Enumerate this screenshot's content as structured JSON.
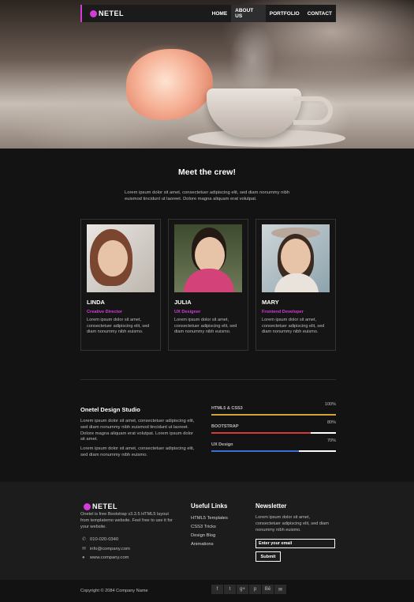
{
  "nav": {
    "logo": "NETEL",
    "items": [
      {
        "label": "HOME",
        "active": false
      },
      {
        "label": "ABOUT US",
        "active": true
      },
      {
        "label": "PORTFOLIO",
        "active": false
      },
      {
        "label": "CONTACT",
        "active": false
      }
    ]
  },
  "colors": {
    "accent": "#d43bd8",
    "bg": "#131313",
    "footer_bg": "#1c1c1c"
  },
  "crew": {
    "title": "Meet the crew!",
    "intro": "Lorem ipsum dolor sit amet, consectetuer adipiscing elit, sed diam nonummy nibh euismod tincidunt ut laoreet. Dolore magna aliquam erat volutpat.",
    "members": [
      {
        "name": "LINDA",
        "role": "Creative Director",
        "desc": "Lorem ipsum dolor sit amet, consectetuer adipiscing elit, sed diam nonummy nibh euismo."
      },
      {
        "name": "JULIA",
        "role": "UX Designer",
        "desc": "Lorem ipsum dolor sit amet, consectetuer adipiscing elit, sed diam nonummy nibh euismo."
      },
      {
        "name": "MARY",
        "role": "Frontend Developer",
        "desc": "Lorem ipsum dolor sit amet, consectetuer adipiscing elit, sed diam nonummy nibh euismo."
      }
    ]
  },
  "studio": {
    "title": "Onetel Design Studio",
    "p1": "Lorem ipsum dolor sit amet, consectetuer adipiscing elit, sed diam nonummy nibh euismod tincidunt ut laoreet. Dolore magna aliquam erat volutpat. Lorem ipsum dolor sit amet.",
    "p2": "Lorem ipsum dolor sit amet, consectetuer adipiscing elit, sed diam nonummy nibh euismo.",
    "skills": [
      {
        "label": "HTML5 & CSS3",
        "percent": "100%",
        "value": 1.0,
        "color": "#d4a13b"
      },
      {
        "label": "BOOTSTRAP",
        "percent": "80%",
        "value": 0.8,
        "color": "#d43b3b"
      },
      {
        "label": "UX Design",
        "percent": "70%",
        "value": 0.7,
        "color": "#3b6fd4"
      }
    ]
  },
  "footer": {
    "logo": "NETEL",
    "about": "Onetel is free Bootstrap v3.3.5 HTML5 layout from templatemo website. Feel free to use it for your website.",
    "phone": "010-020-0340",
    "email": "info@company.com",
    "website": "www.company.com",
    "links_title": "Useful Links",
    "links": [
      "HTML5 Templates",
      "CSS3 Tricks",
      "Design Blog",
      "Animations"
    ],
    "newsletter_title": "Newsletter",
    "newsletter_text": "Lorem ipsum dolor sit amet, consectetuer adipiscing elit, sed diam nonummy nibh euismo.",
    "email_placeholder": "Enter your email",
    "submit_label": "Submit",
    "copyright": "Copyright © 2084 Company Name",
    "socials": [
      "f",
      "t",
      "g+",
      "p",
      "Bē",
      "✉"
    ]
  }
}
